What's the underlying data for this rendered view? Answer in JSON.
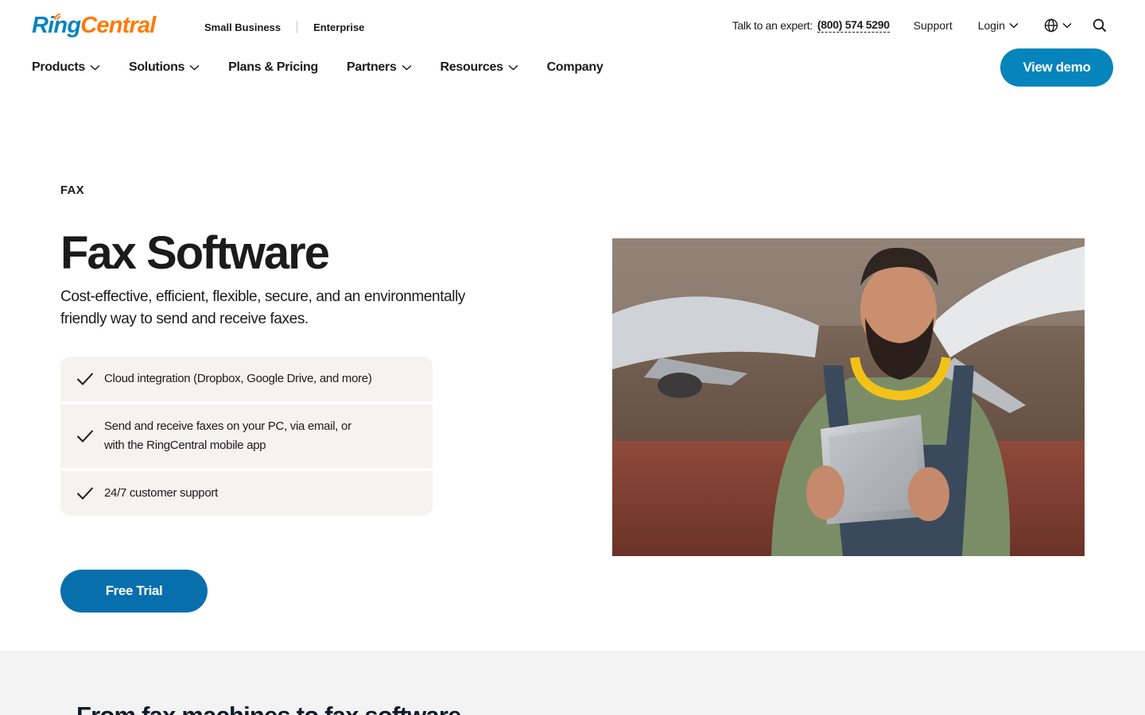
{
  "brand": {
    "logo_part1": "Ring",
    "logo_part2": "Central",
    "color_primary": "#0684bc",
    "color_accent": "#ff7a00"
  },
  "segments": {
    "small_business": "Small Business",
    "enterprise": "Enterprise"
  },
  "utility": {
    "expert_label": "Talk to an expert:",
    "phone": "(800) 574 5290",
    "support": "Support",
    "login": "Login",
    "globe_icon": "globe-icon",
    "search_icon": "search-icon"
  },
  "nav": {
    "items": [
      {
        "label": "Products",
        "has_dropdown": true
      },
      {
        "label": "Solutions",
        "has_dropdown": true
      },
      {
        "label": "Plans & Pricing",
        "has_dropdown": false
      },
      {
        "label": "Partners",
        "has_dropdown": true
      },
      {
        "label": "Resources",
        "has_dropdown": true
      },
      {
        "label": "Company",
        "has_dropdown": false
      }
    ],
    "demo_button": "View demo"
  },
  "hero": {
    "eyebrow": "FAX",
    "title": "Fax Software",
    "subtitle": "Cost-effective, efficient, flexible, secure, and an environmentally friendly way to send and receive faxes.",
    "features": [
      "Cloud integration (Dropbox, Google Drive, and more)",
      "Send and receive faxes on your PC, via email, or with the RingCentral mobile app",
      "24/7 customer support"
    ],
    "cta": "Free Trial",
    "cta_color": "#066fac"
  },
  "section2": {
    "title": "From fax machines to fax software"
  }
}
